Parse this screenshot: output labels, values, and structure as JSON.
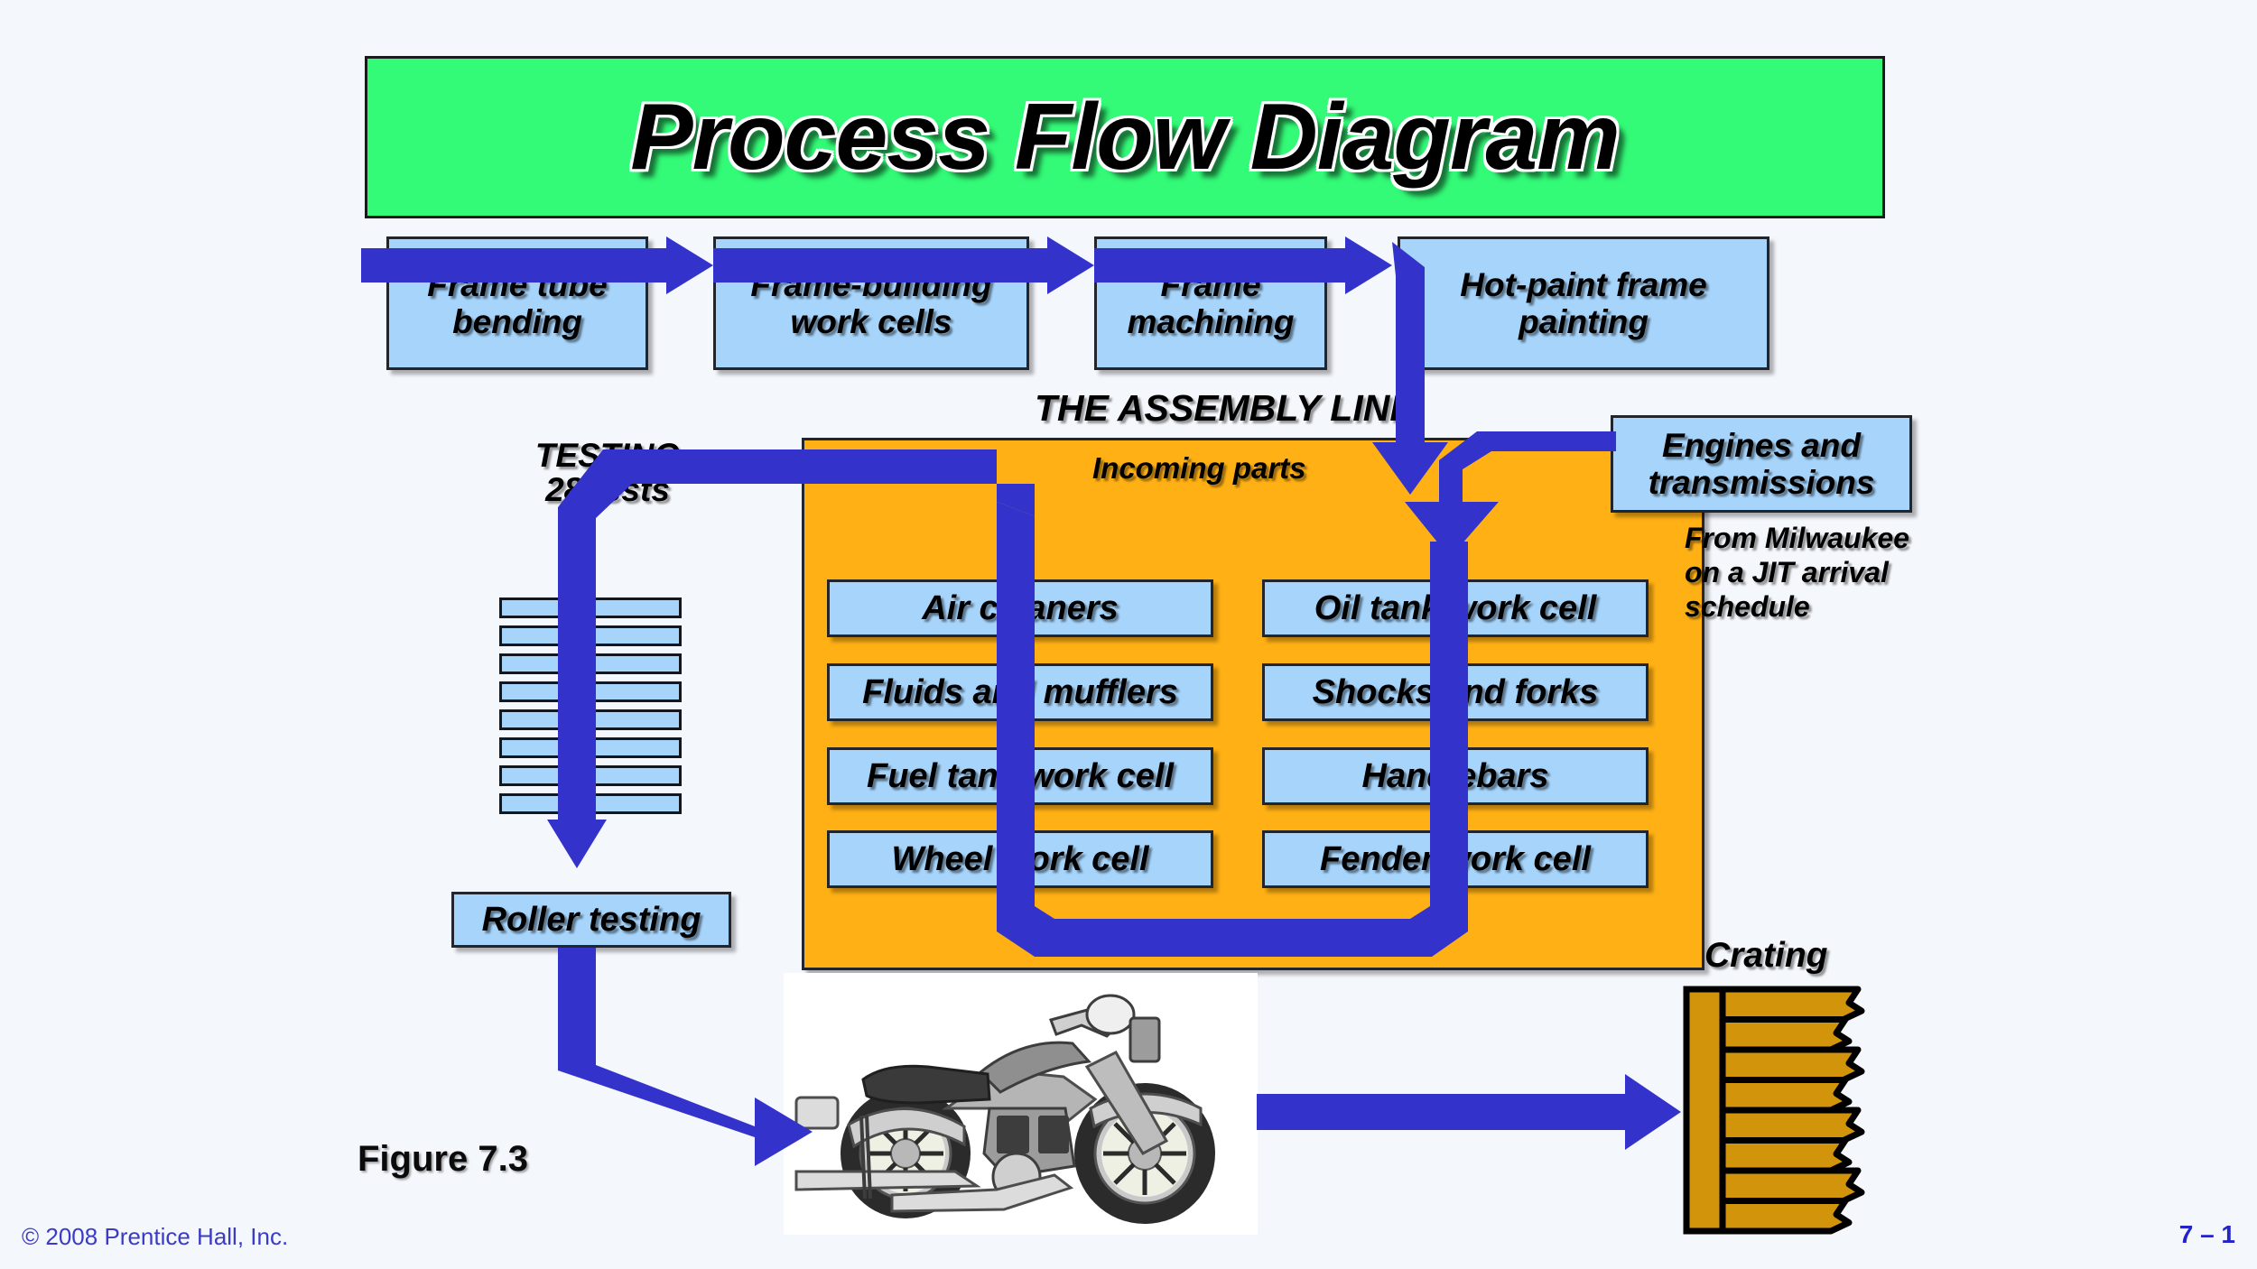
{
  "slide": {
    "title": "Process Flow Diagram",
    "figure_label": "Figure 7.3",
    "copyright": "© 2008 Prentice Hall, Inc.",
    "page_number": "7 – 1",
    "background_color": "#f4f7fc"
  },
  "colors": {
    "title_banner": "#33fa77",
    "box_fill": "#a6d4fb",
    "panel_fill": "#ffb014",
    "arrow": "#3333cc",
    "crate_fill": "#d1940b",
    "outline": "#20252e"
  },
  "frame_line": {
    "boxes": [
      {
        "label": "Frame tube\nbending"
      },
      {
        "label": "Frame-building\nwork cells"
      },
      {
        "label": "Frame\nmachining"
      },
      {
        "label": "Hot-paint\nframe painting"
      }
    ]
  },
  "assembly": {
    "heading": "THE ASSEMBLY LINE",
    "incoming_label": "Incoming parts",
    "left_cells": [
      {
        "label": "Air cleaners"
      },
      {
        "label": "Fluids and mufflers"
      },
      {
        "label": "Fuel tank work cell"
      },
      {
        "label": "Wheel work cell"
      }
    ],
    "right_cells": [
      {
        "label": "Oil tank work cell"
      },
      {
        "label": "Shocks and forks"
      },
      {
        "label": "Handlebars"
      },
      {
        "label": "Fender work cell"
      }
    ]
  },
  "supply": {
    "engines_label": "Engines and\ntransmissions",
    "engines_note": "From Milwaukee\non a JIT arrival\nschedule"
  },
  "testing": {
    "heading": "TESTING",
    "subheading": "28 tests",
    "station_count": 8,
    "roller_label": "Roller testing"
  },
  "output": {
    "crating_label": "Crating",
    "crate_plank_count": 8,
    "product_icon": "motorcycle-icon"
  }
}
